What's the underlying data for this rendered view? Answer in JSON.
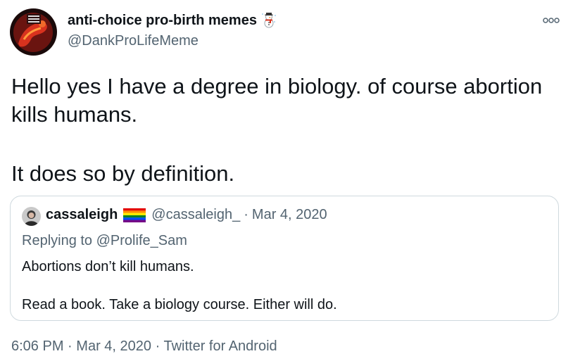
{
  "author": {
    "display_name": "anti-choice pro-birth memes",
    "name_emoji": "snowman-icon",
    "handle": "@DankProLifeMeme"
  },
  "tweet": {
    "paragraph_1": "Hello yes I have a degree in biology. of course abortion kills humans.",
    "paragraph_2": "It does so by definition."
  },
  "quote": {
    "display_name": "cassaleigh",
    "name_emoji": "rainbow-flag-icon",
    "handle": "@cassaleigh_",
    "separator": "·",
    "date": "Mar 4, 2020",
    "replying_prefix": "Replying to",
    "replying_to": "@Prolife_Sam",
    "paragraph_1": "Abortions don’t kill humans.",
    "paragraph_2": "Read a book. Take a biology course. Either will do."
  },
  "footer": {
    "time": "6:06 PM",
    "separator": "·",
    "date": "Mar 4, 2020",
    "source": "Twitter for Android"
  },
  "colors": {
    "primary_text": "#0f1419",
    "secondary_text": "#536471",
    "border": "#cfd9de"
  }
}
